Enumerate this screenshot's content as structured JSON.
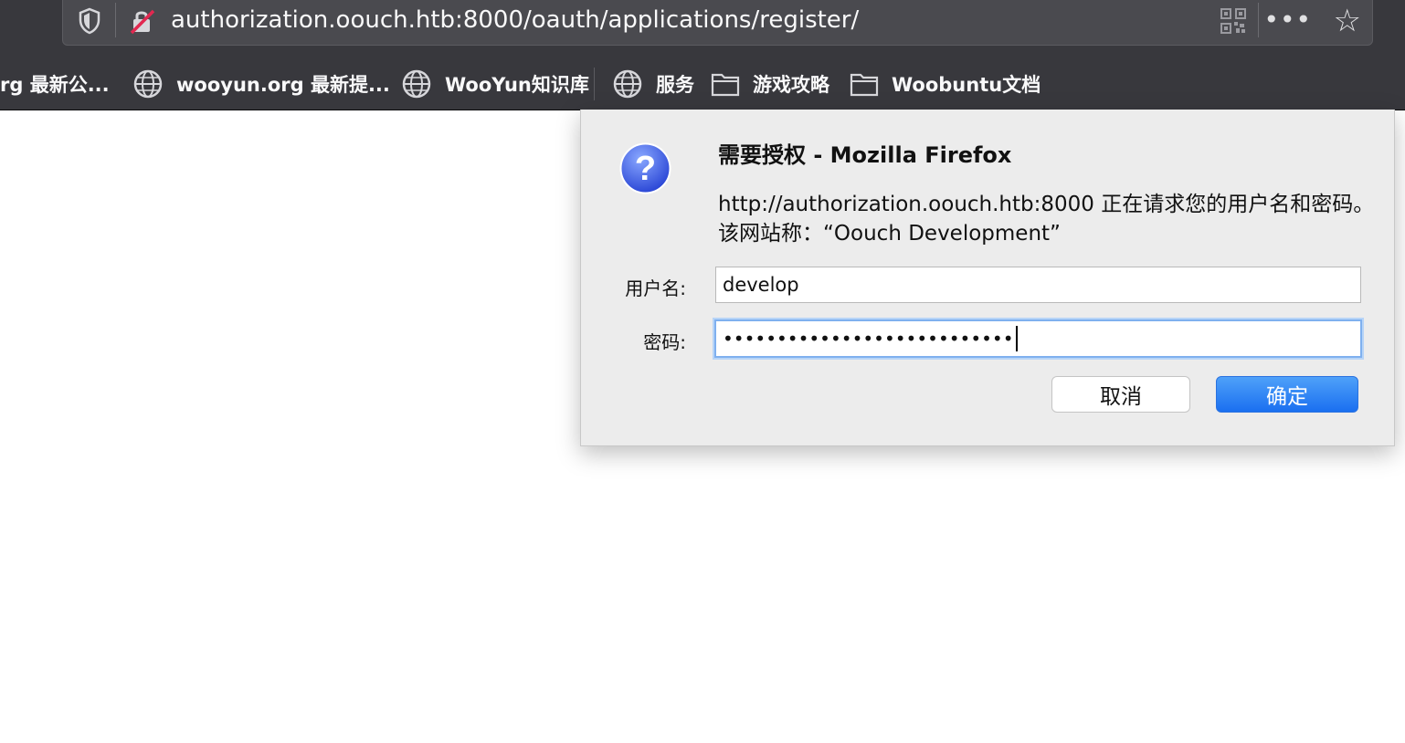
{
  "browser": {
    "url": "authorization.oouch.htb:8000/oauth/applications/register/"
  },
  "bookmarks": [
    {
      "label": "rg 最新公...",
      "icon": "globe-icon"
    },
    {
      "label": "wooyun.org 最新提...",
      "icon": "globe-icon"
    },
    {
      "label": "WooYun知识库",
      "icon": "globe-icon"
    },
    {
      "label": "服务",
      "icon": "globe-icon"
    },
    {
      "label": "游戏攻略",
      "icon": "folder-icon"
    },
    {
      "label": "Woobuntu文档",
      "icon": "folder-icon"
    }
  ],
  "dialog": {
    "title": "需要授权 - Mozilla Firefox",
    "message": "http://authorization.oouch.htb:8000 正在请求您的用户名和密码。该网站称：“Oouch Development”",
    "username_label": "用户名:",
    "username_value": "develop",
    "password_label": "密码:",
    "password_mask": "•••••••••••••••••••••••••••",
    "cancel_label": "取消",
    "ok_label": "确定",
    "ok_color": "#1a6ff0"
  }
}
